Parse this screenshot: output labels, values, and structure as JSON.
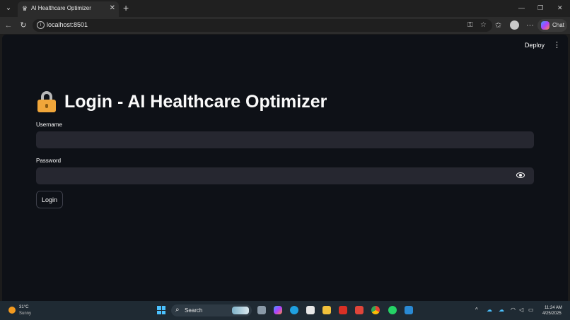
{
  "browser": {
    "tab_title": "AI Healthcare Optimizer",
    "tab_favicon": "streamlit-crown-icon",
    "url": "localhost:8501",
    "copilot_label": "Chat"
  },
  "app_header": {
    "deploy_label": "Deploy",
    "menu_icon": "kebab-menu-icon"
  },
  "page": {
    "title": "Login - AI Healthcare Optimizer",
    "title_icon": "lock-icon",
    "username_label": "Username",
    "username_value": "",
    "password_label": "Password",
    "password_value": "",
    "login_button": "Login"
  },
  "taskbar": {
    "weather_temp": "31°C",
    "weather_desc": "Sunny",
    "search_label": "Search",
    "time": "11:24 AM",
    "date": "4/25/2025"
  },
  "colors": {
    "app_background": "#0e1117",
    "input_background": "#262730",
    "text": "#fafafa",
    "browser_chrome": "#202020"
  }
}
